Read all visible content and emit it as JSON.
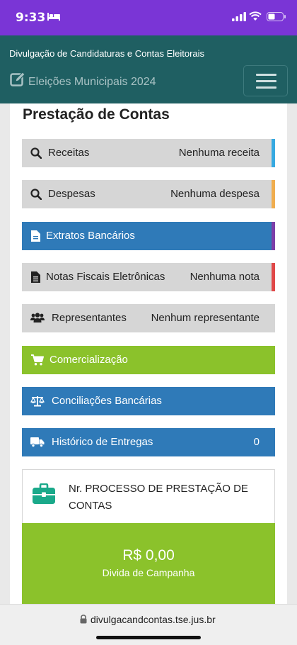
{
  "status_bar": {
    "time": "9:33",
    "icons": [
      "bed-icon",
      "signal-icon",
      "wifi-icon",
      "battery-icon"
    ],
    "color": "#7a35d6"
  },
  "header": {
    "subtitle": "Divulgação de Candidaturas e Contas Eleitorais",
    "title": "Eleições Municipais 2024",
    "icons": [
      "edit-icon",
      "hamburger-menu-icon"
    ],
    "color": "#1f5f62"
  },
  "section": {
    "title": "Prestação de Contas"
  },
  "rows": {
    "receitas": {
      "label": "Receitas",
      "value": "Nenhuma receita",
      "icon": "search-icon",
      "accent": "#36a9e1"
    },
    "despesas": {
      "label": "Despesas",
      "value": "Nenhuma despesa",
      "icon": "search-icon",
      "accent": "#f0ad4e"
    },
    "extratos": {
      "label": "Extratos Bancários",
      "icon": "file-icon",
      "accent": "#7d3fa8"
    },
    "notas": {
      "label": "Notas Fiscais Eletrônicas",
      "value": "Nenhuma nota",
      "icon": "document-icon",
      "accent": "#e04848"
    },
    "representantes": {
      "label": "Representantes",
      "value": "Nenhum representante",
      "icon": "users-icon"
    },
    "comercializacao": {
      "label": "Comercialização",
      "icon": "cart-icon"
    },
    "conciliacoes": {
      "label": "Conciliações Bancárias",
      "icon": "balance-scale-icon"
    },
    "historico": {
      "label": "Histórico de Entregas",
      "value": "0",
      "icon": "truck-icon"
    }
  },
  "process": {
    "text": "Nr. PROCESSO DE PRESTAÇÃO DE CONTAS",
    "icon": "briefcase-icon"
  },
  "debt": {
    "amount": "R$ 0,00",
    "label": "Divida de Campanha"
  },
  "browser": {
    "url": "divulgacandcontas.tse.jus.br",
    "icon": "lock-icon"
  },
  "colors": {
    "gray_row": "#d6d6d6",
    "blue_row": "#2f7ab8",
    "green_row": "#8bc22b",
    "icon_teal": "#1aa98a"
  }
}
